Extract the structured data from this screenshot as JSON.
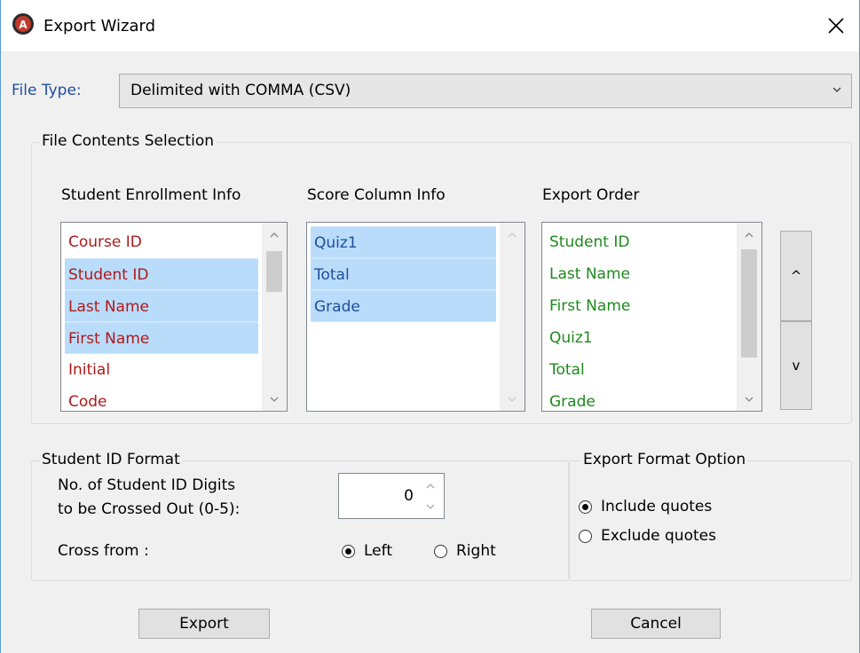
{
  "window": {
    "title": "Export Wizard"
  },
  "file_type": {
    "label": "File Type:",
    "value": "Delimited with COMMA (CSV)"
  },
  "contents": {
    "group_title": "File Contents Selection",
    "enrollment": {
      "header": "Student Enrollment Info",
      "items": [
        {
          "label": "Course ID",
          "selected": false
        },
        {
          "label": "Student ID",
          "selected": true
        },
        {
          "label": "Last Name",
          "selected": true
        },
        {
          "label": "First Name",
          "selected": true
        },
        {
          "label": "Initial",
          "selected": false
        },
        {
          "label": "Code",
          "selected": false
        }
      ]
    },
    "score": {
      "header": "Score Column Info",
      "items": [
        {
          "label": "Quiz1",
          "selected": true
        },
        {
          "label": "Total",
          "selected": true
        },
        {
          "label": "Grade",
          "selected": true
        }
      ]
    },
    "order": {
      "header": "Export Order",
      "items": [
        {
          "label": "Student ID"
        },
        {
          "label": "Last Name"
        },
        {
          "label": "First Name"
        },
        {
          "label": "Quiz1"
        },
        {
          "label": "Total"
        },
        {
          "label": "Grade"
        }
      ],
      "move_up_label": "^",
      "move_down_label": "v"
    }
  },
  "id_format": {
    "group_title": "Student ID Format",
    "digits_label_line1": "No. of Student ID Digits",
    "digits_label_line2": "to be Crossed Out (0-5):",
    "digits_value": "0",
    "cross_from_label": "Cross from :",
    "left_label": "Left",
    "right_label": "Right",
    "selected": "Left"
  },
  "format_option": {
    "group_title": "Export Format Option",
    "include_label": "Include quotes",
    "exclude_label": "Exclude quotes",
    "selected": "include"
  },
  "buttons": {
    "export_label": "Export",
    "cancel_label": "Cancel"
  },
  "colors": {
    "enrollment_text": "#b01919",
    "score_text": "#1f4e9c",
    "order_text": "#1d8a1d",
    "selection": "#b9dcfb"
  }
}
